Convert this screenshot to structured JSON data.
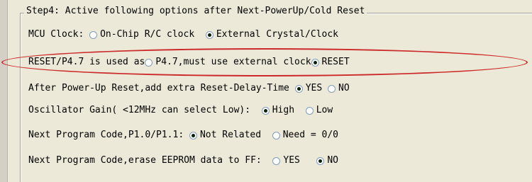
{
  "group_title": "Step4: Active following options after Next-PowerUp/Cold Reset",
  "rows": [
    {
      "label": "MCU Clock: ",
      "options": [
        {
          "text": "On-Chip R/C clock  ",
          "checked": false
        },
        {
          "text": "External Crystal/Clock",
          "checked": true
        }
      ]
    },
    {
      "label": "RESET/P4.7 is used as",
      "options": [
        {
          "text": "P4.7,must use external clock",
          "checked": false
        },
        {
          "text": "RESET",
          "checked": true
        }
      ]
    },
    {
      "label": "After Power-Up Reset,add extra Reset-Delay-Time ",
      "options": [
        {
          "text": "YES ",
          "checked": true
        },
        {
          "text": "NO",
          "checked": false
        }
      ]
    },
    {
      "label": "Oscillator Gain( <12MHz can select Low):  ",
      "options": [
        {
          "text": "High  ",
          "checked": true
        },
        {
          "text": "Low",
          "checked": false
        }
      ]
    },
    {
      "label": "Next Program Code,P1.0/P1.1: ",
      "options": [
        {
          "text": "Not Related  ",
          "checked": true
        },
        {
          "text": "Need = 0/0",
          "checked": false
        }
      ]
    },
    {
      "label": "Next Program Code,erase EEPROM data to FF:  ",
      "options": [
        {
          "text": "YES   ",
          "checked": false
        },
        {
          "text": "NO",
          "checked": true
        }
      ]
    }
  ],
  "colors": {
    "highlight": "#cc2a2a",
    "background": "#ece9d8"
  }
}
